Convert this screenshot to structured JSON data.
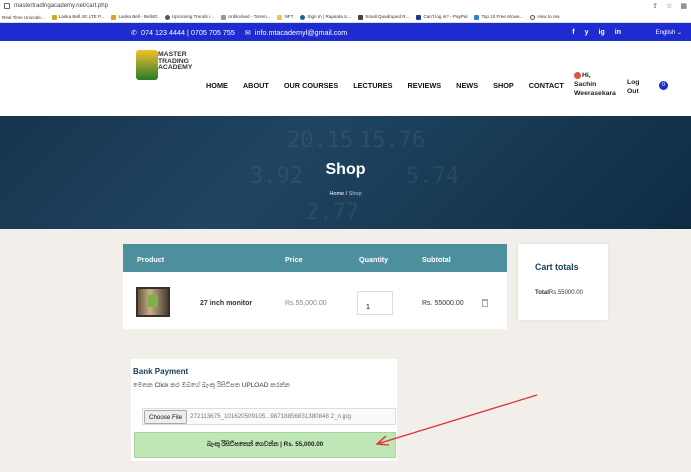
{
  "browser": {
    "url": "mastertradingacademy.net/cart.php",
    "bookmarks": [
      "Real Time Unicode...",
      "Lanka Bell 4G LTE P...",
      "Lanka Bell - Bell4G",
      "Upcoming Trends i...",
      "Unblocked - Torren...",
      "NFT",
      "Sign In | Rajarata U...",
      "Small Quadruped R...",
      "Can't log in? - PayPal",
      "Top 10 Free Movie...",
      "How to rea"
    ]
  },
  "topbar": {
    "phone": "074 123 4444 | 0705 705 755",
    "email": "info.mtacademyl@gmail.com",
    "social": [
      "f",
      "y",
      "ig",
      "in"
    ],
    "language": "English"
  },
  "navbar": {
    "logo_text": [
      "MASTER",
      "TRADING",
      "ACADEMY"
    ],
    "items": [
      "HOME",
      "ABOUT",
      "OUR COURSES",
      "LECTURES",
      "REVIEWS",
      "NEWS",
      "SHOP",
      "CONTACT"
    ],
    "user_greeting": "Hi,",
    "user_name_1": "Sachin",
    "user_name_2": "Weerasekara",
    "logout_1": "Log",
    "logout_2": "Out",
    "cart_count": "0"
  },
  "hero": {
    "title": "Shop",
    "breadcrumb_home": "Home",
    "breadcrumb_sep": "/",
    "breadcrumb_current": "Shop"
  },
  "cart": {
    "headers": [
      "Product",
      "Price",
      "Quantity",
      "Subtotal"
    ],
    "item": {
      "name": "27 inch monitor",
      "price": "Rs.55,000.00",
      "quantity": "1",
      "subtotal": "Rs. 55000.00"
    }
  },
  "totals": {
    "title": "Cart totals",
    "total_label": "Total",
    "total_value": "Rs.55000.00"
  },
  "bank": {
    "title": "Bank Payment",
    "instruction": "මෙතන Click කර ඔබගේ බැංකු රිසිට්පත UPLOAD කරන්න",
    "choose_file": "Choose File",
    "file_name": "272113675_101620509105...98718856831380848 2_n.jpg",
    "pay_button": "බැංකු රිසිට්පතෙන් ගෙවන්න | Rs. 55,000.00"
  },
  "colors": {
    "topbar": "#1d2bd1",
    "table_header": "#4e8f9e",
    "pay_button": "#bfe6b6",
    "arrow": "#e03030"
  }
}
